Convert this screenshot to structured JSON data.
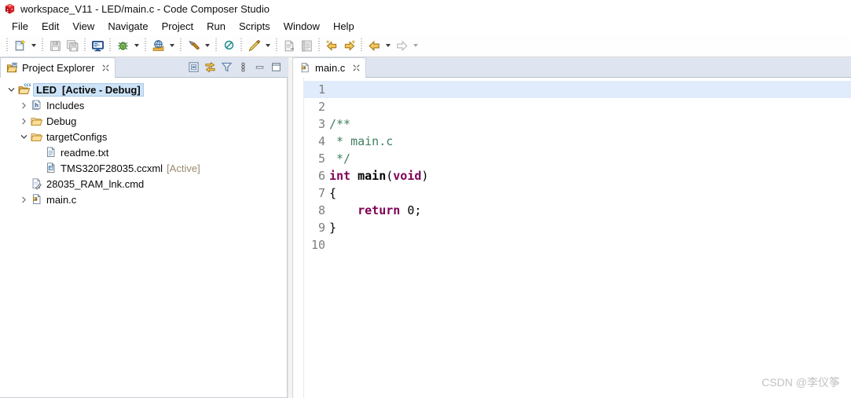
{
  "window": {
    "title": "workspace_V11 - LED/main.c - Code Composer Studio",
    "app_icon": "ccs-cube-icon"
  },
  "menubar": {
    "items": [
      {
        "label": "File"
      },
      {
        "label": "Edit"
      },
      {
        "label": "View"
      },
      {
        "label": "Navigate"
      },
      {
        "label": "Project"
      },
      {
        "label": "Run"
      },
      {
        "label": "Scripts"
      },
      {
        "label": "Window"
      },
      {
        "label": "Help"
      }
    ]
  },
  "toolbar": {
    "buttons": [
      {
        "name": "new-file-icon",
        "tooltip": "New",
        "enabled": true,
        "dropdown": true
      },
      {
        "name": "save-icon",
        "tooltip": "Save",
        "enabled": false,
        "dropdown": false
      },
      {
        "name": "save-all-icon",
        "tooltip": "Save All",
        "enabled": false,
        "dropdown": false
      },
      {
        "name": "console-icon",
        "tooltip": "Open Console",
        "enabled": true,
        "dropdown": false
      },
      {
        "name": "debug-bug-icon",
        "tooltip": "Debug",
        "enabled": true,
        "dropdown": true
      },
      {
        "name": "resume-launch-icon",
        "tooltip": "Launch Selected Configuration",
        "enabled": true,
        "dropdown": true
      },
      {
        "name": "build-hammer-icon",
        "tooltip": "Build",
        "enabled": true,
        "dropdown": true
      },
      {
        "name": "search-scope-icon",
        "tooltip": "Search",
        "enabled": true,
        "dropdown": false
      },
      {
        "name": "marker-pencil-icon",
        "tooltip": "Toggle Marker",
        "enabled": true,
        "dropdown": true
      },
      {
        "name": "export-doc-icon",
        "tooltip": "Export",
        "enabled": false,
        "dropdown": false
      },
      {
        "name": "list-doc-icon",
        "tooltip": "Show Properties",
        "enabled": false,
        "dropdown": false
      },
      {
        "name": "prev-annotation-icon",
        "tooltip": "Previous Annotation",
        "enabled": true,
        "dropdown": false
      },
      {
        "name": "next-annotation-icon",
        "tooltip": "Next Annotation",
        "enabled": true,
        "dropdown": false
      },
      {
        "name": "back-arrow-icon",
        "tooltip": "Back",
        "enabled": true,
        "dropdown": true
      },
      {
        "name": "forward-arrow-icon",
        "tooltip": "Forward",
        "enabled": false,
        "dropdown": true
      }
    ]
  },
  "project_explorer": {
    "tab_label": "Project Explorer",
    "tab_icon": "project-explorer-icon",
    "tools": [
      {
        "name": "collapse-all-icon",
        "tooltip": "Collapse All"
      },
      {
        "name": "link-with-editor-icon",
        "tooltip": "Link with Editor"
      },
      {
        "name": "filter-icon",
        "tooltip": "Filters"
      },
      {
        "name": "view-menu-icon",
        "tooltip": "View Menu"
      },
      {
        "name": "minimize-icon",
        "tooltip": "Minimize"
      },
      {
        "name": "maximize-icon",
        "tooltip": "Maximize"
      }
    ],
    "tree": [
      {
        "label": "LED",
        "suffix": "[Active - Debug]",
        "icon": "ccs-project-folder-icon",
        "indent": 0,
        "twisty": "down",
        "selected": true,
        "bold": true
      },
      {
        "label": "Includes",
        "suffix": "",
        "icon": "includes-header-icon",
        "indent": 1,
        "twisty": "right",
        "selected": false,
        "bold": false
      },
      {
        "label": "Debug",
        "suffix": "",
        "icon": "folder-icon",
        "indent": 1,
        "twisty": "right",
        "selected": false,
        "bold": false
      },
      {
        "label": "targetConfigs",
        "suffix": "",
        "icon": "folder-icon",
        "indent": 1,
        "twisty": "down",
        "selected": false,
        "bold": false
      },
      {
        "label": "readme.txt",
        "suffix": "",
        "icon": "text-file-icon",
        "indent": 2,
        "twisty": "none",
        "selected": false,
        "bold": false
      },
      {
        "label": "TMS320F28035.ccxml",
        "suffix": "[Active]",
        "icon": "ccxml-file-icon",
        "indent": 2,
        "twisty": "none",
        "selected": false,
        "bold": false
      },
      {
        "label": "28035_RAM_lnk.cmd",
        "suffix": "",
        "icon": "cmd-file-icon",
        "indent": 1,
        "twisty": "none",
        "selected": false,
        "bold": false
      },
      {
        "label": "main.c",
        "suffix": "",
        "icon": "c-file-icon",
        "indent": 1,
        "twisty": "right",
        "selected": false,
        "bold": false
      }
    ]
  },
  "editor": {
    "tab_label": "main.c",
    "tab_icon": "c-file-icon",
    "tab_close_icon": "close-icon",
    "current_line": 1,
    "lines": [
      {
        "n": "1",
        "tokens": []
      },
      {
        "n": "2",
        "tokens": []
      },
      {
        "n": "3",
        "tokens": [
          {
            "t": "/**",
            "c": "cm"
          }
        ]
      },
      {
        "n": "4",
        "tokens": [
          {
            "t": " * main.c",
            "c": "cm"
          }
        ]
      },
      {
        "n": "5",
        "tokens": [
          {
            "t": " */",
            "c": "cm"
          }
        ]
      },
      {
        "n": "6",
        "tokens": [
          {
            "t": "int",
            "c": "k"
          },
          {
            "t": " ",
            "c": "pl"
          },
          {
            "t": "main",
            "c": "fn"
          },
          {
            "t": "(",
            "c": "pl"
          },
          {
            "t": "void",
            "c": "k"
          },
          {
            "t": ")",
            "c": "pl"
          }
        ]
      },
      {
        "n": "7",
        "tokens": [
          {
            "t": "{",
            "c": "pl"
          }
        ]
      },
      {
        "n": "8",
        "tokens": [
          {
            "t": "    ",
            "c": "pl"
          },
          {
            "t": "return",
            "c": "k"
          },
          {
            "t": " ",
            "c": "pl"
          },
          {
            "t": "0",
            "c": "num"
          },
          {
            "t": ";",
            "c": "pl"
          }
        ]
      },
      {
        "n": "9",
        "tokens": [
          {
            "t": "}",
            "c": "pl"
          }
        ]
      },
      {
        "n": "10",
        "tokens": []
      }
    ]
  },
  "watermark": {
    "text": "CSDN @李仪筝"
  },
  "colors": {
    "keyword": "#7f0055",
    "comment": "#3f7f5f",
    "current_line_highlight": "#e0ebfb",
    "selection": "#cde3f7",
    "tab_bar": "#dfe5f0",
    "accent_folder": "#e8a33d"
  }
}
